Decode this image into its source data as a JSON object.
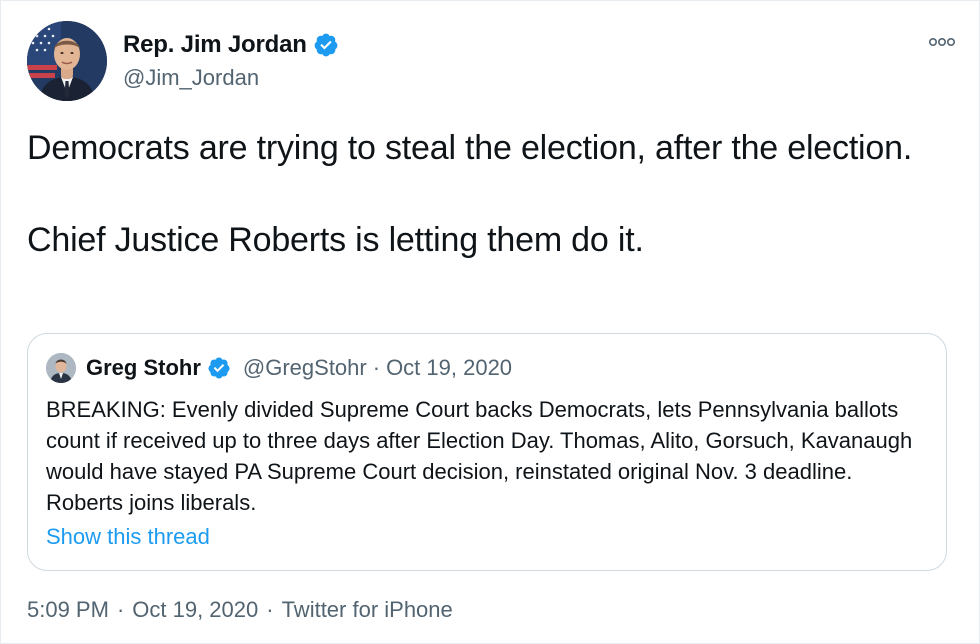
{
  "tweet": {
    "author": {
      "display_name": "Rep. Jim Jordan",
      "handle": "@Jim_Jordan",
      "verified": true
    },
    "paragraphs": [
      "Democrats are trying to steal the election, after the election.",
      "Chief Justice Roberts is letting them do it."
    ],
    "time": "5:09 PM",
    "date": "Oct 19, 2020",
    "source": "Twitter for iPhone"
  },
  "quote": {
    "display_name": "Greg Stohr",
    "handle": "@GregStohr",
    "date": "Oct 19, 2020",
    "verified": true,
    "text": "BREAKING: Evenly divided Supreme Court backs Democrats, lets Pennsylvania ballots count if received up to three days after Election Day. Thomas, Alito, Gorsuch, Kavanaugh would have stayed PA Supreme Court decision, reinstated original Nov. 3 deadline. Roberts joins liberals.",
    "show_thread": "Show this thread"
  },
  "separators": {
    "dot": "·"
  },
  "icons": {
    "verified": "verified-badge-icon",
    "more": "more-options-icon"
  },
  "colors": {
    "verified_blue": "#1d9bf0",
    "link_blue": "#1d9bf0",
    "muted_text": "#536471"
  }
}
